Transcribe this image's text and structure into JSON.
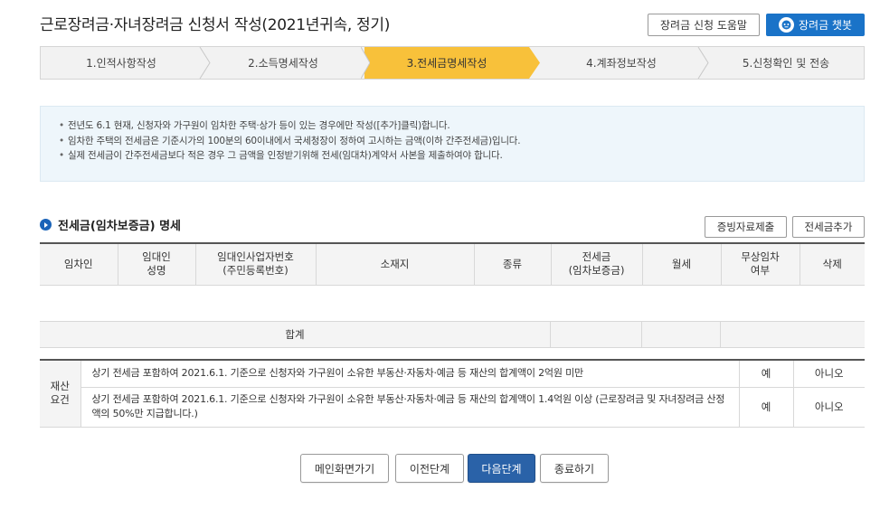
{
  "header": {
    "title": "근로장려금·자녀장려금 신청서 작성(2021년귀속, 정기)",
    "help_label": "장려금 신청 도움말",
    "chatbot_label": "장려금 챗봇"
  },
  "steps": [
    {
      "label": "1.인적사항작성",
      "active": false
    },
    {
      "label": "2.소득명세작성",
      "active": false
    },
    {
      "label": "3.전세금명세작성",
      "active": true
    },
    {
      "label": "4.계좌정보작성",
      "active": false
    },
    {
      "label": "5.신청확인 및 전송",
      "active": false
    }
  ],
  "notice": [
    "전년도 6.1 현재, 신청자와 가구원이 임차한 주택·상가 등이 있는 경우에만 작성([추가]클릭)합니다.",
    "임차한 주택의 전세금은 기준시가의 100분의 60이내에서 국세청장이 정하여 고시하는 금액(이하 간주전세금)입니다.",
    "실제 전세금이 간주전세금보다 적은 경우 그 금액을 인정받기위해 전세(임대차)계약서 사본을 제출하여야 합니다."
  ],
  "section": {
    "title": "전세금(임차보증금) 명세",
    "evidence_label": "증빙자료제출",
    "add_label": "전세금추가"
  },
  "table": {
    "headers": {
      "tenant": "임차인",
      "lessor_name_1": "임대인",
      "lessor_name_2": "성명",
      "lessor_id_1": "임대인사업자번호",
      "lessor_id_2": "(주민등록번호)",
      "address": "소재지",
      "type": "종류",
      "deposit_1": "전세금",
      "deposit_2": "(임차보증금)",
      "rent": "월세",
      "free_1": "무상임차",
      "free_2": "여부",
      "delete": "삭제"
    },
    "total_label": "합계"
  },
  "assets": {
    "label_1": "재산",
    "label_2": "요건",
    "rows": [
      {
        "text": "상기 전세금 포함하여 2021.6.1. 기준으로 신청자와 가구원이 소유한 부동산·자동차·예금 등 재산의 합계액이 2억원 미만",
        "yes": "예",
        "no": "아니오"
      },
      {
        "text": "상기 전세금 포함하여 2021.6.1. 기준으로 신청자와 가구원이 소유한 부동산·자동차·예금 등 재산의 합계액이 1.4억원 이상 (근로장려금 및 자녀장려금 산정액의 50%만 지급합니다.)",
        "yes": "예",
        "no": "아니오"
      }
    ]
  },
  "buttons": {
    "main": "메인화면가기",
    "prev": "이전단계",
    "next": "다음단계",
    "close": "종료하기"
  },
  "colors": {
    "accent": "#1a73c8",
    "active_step": "#f8c13a",
    "primary_button": "#2a62a8"
  }
}
